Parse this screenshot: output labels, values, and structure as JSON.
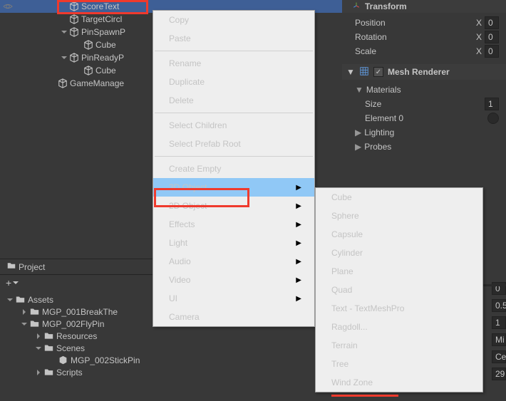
{
  "hierarchy": {
    "items": [
      {
        "label": "ScoreText",
        "selected": true,
        "pad": 84,
        "fold": ""
      },
      {
        "label": "TargetCircl",
        "selected": false,
        "pad": 84,
        "fold": ""
      },
      {
        "label": "PinSpawnP",
        "selected": false,
        "pad": 84,
        "fold": "down"
      },
      {
        "label": "Cube",
        "selected": false,
        "pad": 104,
        "fold": ""
      },
      {
        "label": "PinReadyP",
        "selected": false,
        "pad": 84,
        "fold": "down"
      },
      {
        "label": "Cube",
        "selected": false,
        "pad": 104,
        "fold": ""
      },
      {
        "label": "GameManage",
        "selected": false,
        "pad": 68,
        "fold": ""
      }
    ]
  },
  "project": {
    "tab": "Project",
    "items": [
      {
        "label": "Assets",
        "pad": 8,
        "fold": "down",
        "type": "folder"
      },
      {
        "label": "MGP_001BreakThe",
        "pad": 28,
        "fold": "right",
        "type": "folder"
      },
      {
        "label": "MGP_002FlyPin",
        "pad": 28,
        "fold": "down",
        "type": "folder"
      },
      {
        "label": "Resources",
        "pad": 48,
        "fold": "right",
        "type": "folder"
      },
      {
        "label": "Scenes",
        "pad": 48,
        "fold": "down",
        "type": "folder"
      },
      {
        "label": "MGP_002StickPin",
        "pad": 68,
        "fold": "",
        "type": "scene"
      },
      {
        "label": "Scripts",
        "pad": 48,
        "fold": "right",
        "type": "folder"
      }
    ]
  },
  "inspector": {
    "transform": {
      "title": "Transform",
      "position": "Position",
      "rotation": "Rotation",
      "scale": "Scale",
      "x": "X",
      "val": "0"
    },
    "meshRenderer": {
      "title": "Mesh Renderer",
      "materials": "Materials",
      "size": "Size",
      "sizeVal": "1",
      "element0": "Element 0",
      "lighting": "Lighting",
      "probes": "Probes"
    }
  },
  "rightStrip": {
    "vals": [
      "0",
      "0.5",
      "1",
      "Mi",
      "Ce",
      "29"
    ]
  },
  "contextMenu": {
    "items": [
      {
        "label": "Copy"
      },
      {
        "label": "Paste"
      },
      {
        "sep": true
      },
      {
        "label": "Rename"
      },
      {
        "label": "Duplicate"
      },
      {
        "label": "Delete"
      },
      {
        "sep": true
      },
      {
        "label": "Select Children",
        "disabled": true
      },
      {
        "label": "Select Prefab Root",
        "disabled": true
      },
      {
        "sep": true
      },
      {
        "label": "Create Empty"
      },
      {
        "label": "3D Object",
        "sub": true,
        "hl": true
      },
      {
        "label": "2D Object",
        "sub": true
      },
      {
        "label": "Effects",
        "sub": true
      },
      {
        "label": "Light",
        "sub": true
      },
      {
        "label": "Audio",
        "sub": true
      },
      {
        "label": "Video",
        "sub": true
      },
      {
        "label": "UI",
        "sub": true
      },
      {
        "label": "Camera"
      }
    ]
  },
  "submenu": {
    "items": [
      {
        "label": "Cube"
      },
      {
        "label": "Sphere"
      },
      {
        "label": "Capsule"
      },
      {
        "label": "Cylinder"
      },
      {
        "label": "Plane"
      },
      {
        "label": "Quad"
      },
      {
        "label": "Text - TextMeshPro"
      },
      {
        "label": "Ragdoll..."
      },
      {
        "label": "Terrain"
      },
      {
        "label": "Tree"
      },
      {
        "label": "Wind Zone"
      }
    ]
  }
}
